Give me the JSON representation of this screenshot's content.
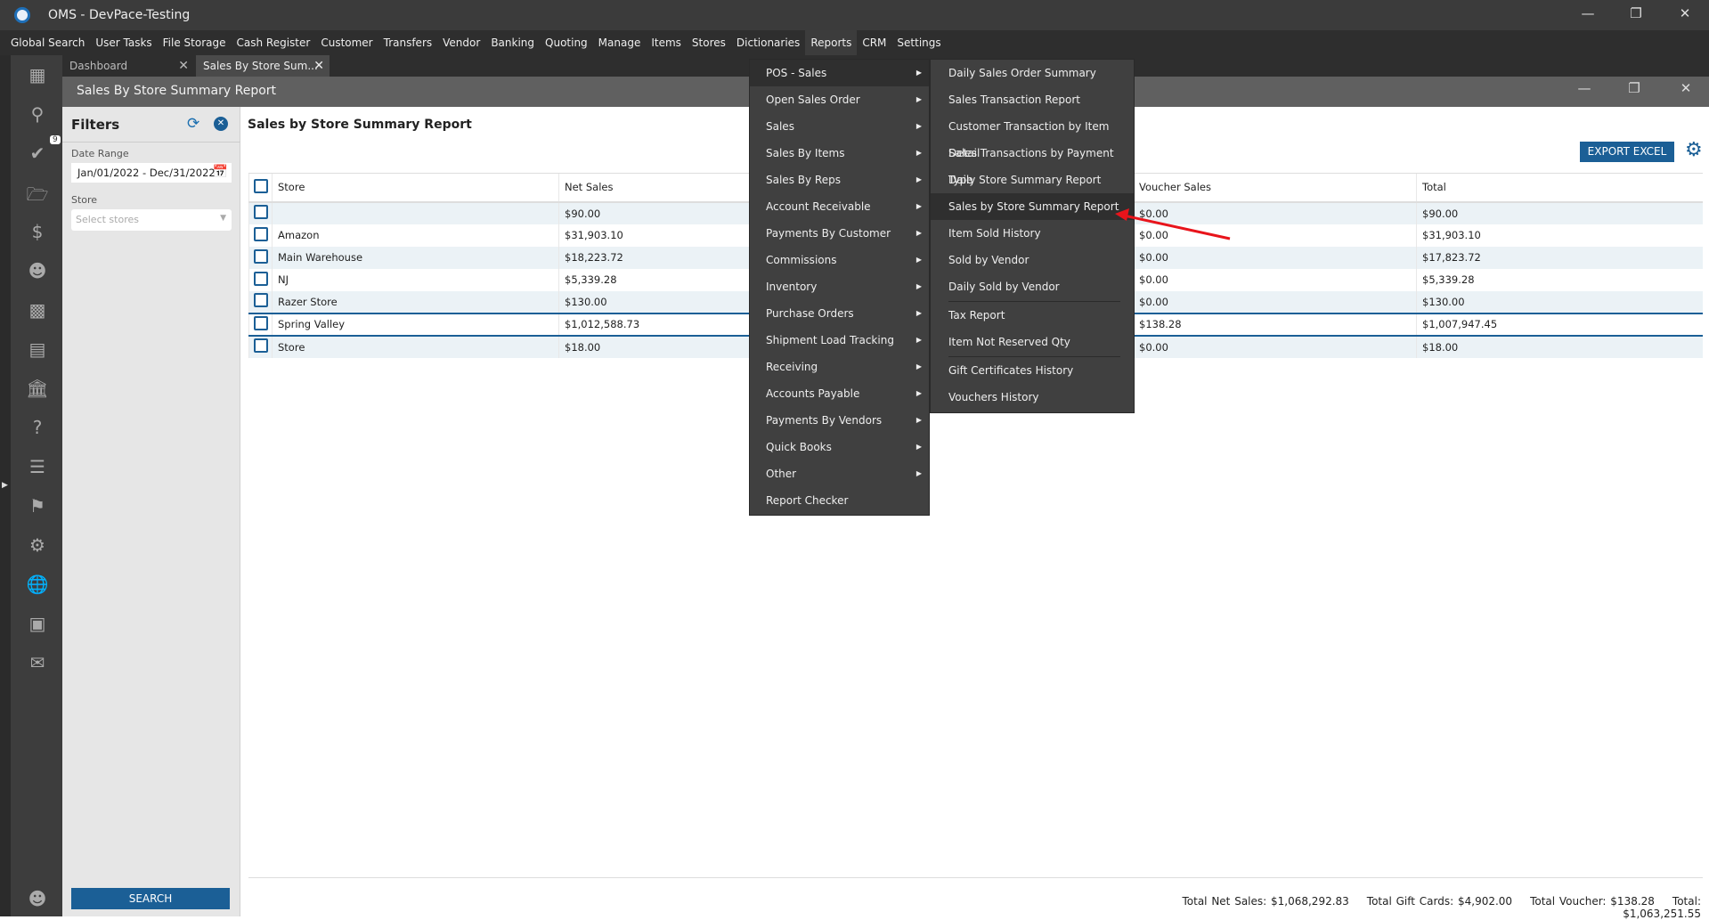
{
  "app": {
    "title": "OMS - DevPace-Testing"
  },
  "menubar": [
    "Global Search",
    "User Tasks",
    "File Storage",
    "Cash Register",
    "Customer",
    "Transfers",
    "Vendor",
    "Banking",
    "Quoting",
    "Manage",
    "Items",
    "Stores",
    "Dictionaries",
    "Reports",
    "CRM",
    "Settings"
  ],
  "tabs": [
    {
      "label": "Dashboard"
    },
    {
      "label": "Sales By Store Sum..."
    }
  ],
  "window": {
    "title": "Sales By Store Summary Report"
  },
  "sidebar": {
    "badge": "9",
    "icons": [
      "dashboard-icon",
      "search-icon",
      "tasks-icon",
      "folder-icon",
      "dollar-icon",
      "contact-icon",
      "calculator-icon",
      "store-icon",
      "bank-icon",
      "clipboard-question-icon",
      "clipboard-icon",
      "tag-icon",
      "gear-icon",
      "globe-icon",
      "monitor-icon",
      "chat-icon"
    ]
  },
  "filters": {
    "title": "Filters",
    "date_label": "Date Range",
    "date_value": "Jan/01/2022 - Dec/31/2022",
    "store_label": "Store",
    "store_placeholder": "Select stores",
    "search_label": "SEARCH"
  },
  "report": {
    "title": "Sales by Store Summary Report",
    "export_label": "EXPORT EXCEL",
    "columns": {
      "store": "Store",
      "net": "Net Sales",
      "voucher": "Voucher Sales",
      "total": "Total"
    },
    "rows": [
      {
        "store": "",
        "net": "$90.00",
        "voucher": "$0.00",
        "total": "$90.00"
      },
      {
        "store": "Amazon",
        "net": "$31,903.10",
        "voucher": "$0.00",
        "total": "$31,903.10"
      },
      {
        "store": "Main Warehouse",
        "net": "$18,223.72",
        "voucher": "$0.00",
        "total": "$17,823.72"
      },
      {
        "store": "NJ",
        "net": "$5,339.28",
        "voucher": "$0.00",
        "total": "$5,339.28"
      },
      {
        "store": "Razer Store",
        "net": "$130.00",
        "voucher": "$0.00",
        "total": "$130.00"
      },
      {
        "store": "Spring Valley",
        "net": "$1,012,588.73",
        "voucher": "$138.28",
        "total": "$1,007,947.45"
      },
      {
        "store": "Store",
        "net": "$18.00",
        "voucher": "$0.00",
        "total": "$18.00"
      }
    ]
  },
  "footer": {
    "net": "Total Net Sales: $1,068,292.83",
    "gift": "Total Gift Cards: $4,902.00",
    "voucher": "Total Voucher: $138.28",
    "total": "Total: $1,063,251.55"
  },
  "reports_menu": [
    "POS - Sales",
    "Open Sales Order",
    "Sales",
    "Sales By Items",
    "Sales By Reps",
    "Account Receivable",
    "Payments By Customer",
    "Commissions",
    "Inventory",
    "Purchase Orders",
    "Shipment Load Tracking",
    "Receiving",
    "Accounts Payable",
    "Payments By Vendors",
    "Quick Books",
    "Other",
    "Report Checker"
  ],
  "pos_sales_submenu": [
    "Daily Sales Order Summary",
    "Sales Transaction Report",
    "Customer Transaction by Item Detail",
    "Sales Transactions by Payment Type",
    "Daily Store Summary Report",
    "Sales by Store Summary Report",
    "Item Sold History",
    "Sold by Vendor",
    "Daily Sold by Vendor",
    "Tax Report",
    "Item Not Reserved Qty",
    "Gift Certificates History",
    "Vouchers History"
  ],
  "colors": {
    "accent": "#1b5f96",
    "menu_bg": "#404040",
    "highlight": "#2f2f2f"
  }
}
